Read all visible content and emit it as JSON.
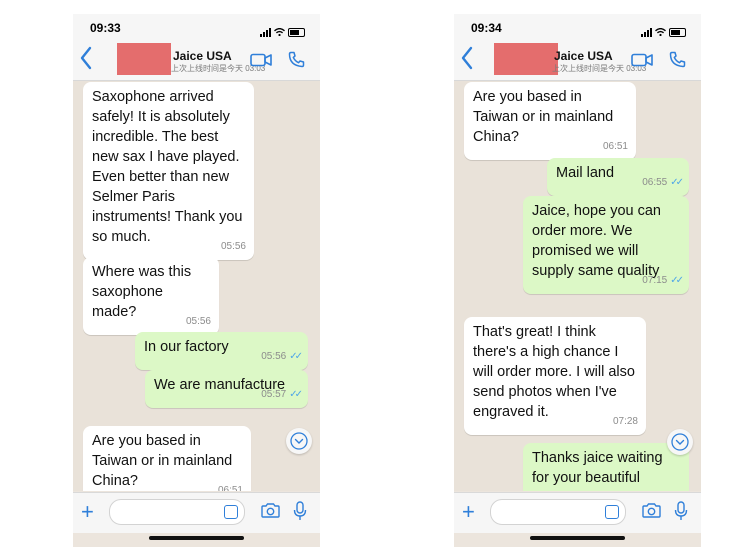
{
  "left": {
    "status": {
      "time": "09:33"
    },
    "header": {
      "contact_name": "Jaice USA",
      "last_seen": "上次上线时间是今天 03:03"
    },
    "messages": [
      {
        "dir": "in",
        "text": "Saxophone arrived safely! It is absolutely incredible. The best new sax I have played. Even better than new Selmer Paris instruments! Thank you so much.",
        "time": "05:56"
      },
      {
        "dir": "in",
        "text": "Where was this saxophone made?",
        "time": "05:56"
      },
      {
        "dir": "out",
        "text": "In our factory",
        "time": "05:56"
      },
      {
        "dir": "out",
        "text": "We are manufacture",
        "time": "05:57"
      },
      {
        "dir": "in",
        "text": "Are you based in Taiwan or in mainland China?",
        "time": "06:51"
      }
    ]
  },
  "right": {
    "status": {
      "time": "09:34"
    },
    "header": {
      "contact_name": "Jaice USA",
      "last_seen": "上次上线时间是今天 03:03"
    },
    "messages": [
      {
        "dir": "in",
        "text": "Are you based in Taiwan or in mainland China?",
        "time": "06:51"
      },
      {
        "dir": "out",
        "text": "Mail land",
        "time": "06:55"
      },
      {
        "dir": "out",
        "text": "Jaice, hope you can order more. We promised we will supply same quality",
        "time": "07:15"
      },
      {
        "dir": "in",
        "text": "That's great! I think there's a high chance I will order more. I will also send photos when I've engraved it.",
        "time": "07:28"
      },
      {
        "dir": "out",
        "text": "Thanks jaice waiting for your beautiful",
        "time": ""
      }
    ]
  },
  "icons": {
    "back": "chevron-left-icon",
    "video": "video-camera-icon",
    "call": "phone-icon",
    "attach": "plus-icon",
    "sticker": "sticker-icon",
    "camera": "camera-icon",
    "mic": "microphone-icon",
    "scroll": "chevron-down-circle-icon"
  },
  "colors": {
    "accent": "#2f7fd9",
    "outgoing_bubble": "#dcf8c6",
    "incoming_bubble": "#ffffff",
    "chat_background": "#e9e2d9",
    "read_ticks": "#4fa6e8"
  }
}
